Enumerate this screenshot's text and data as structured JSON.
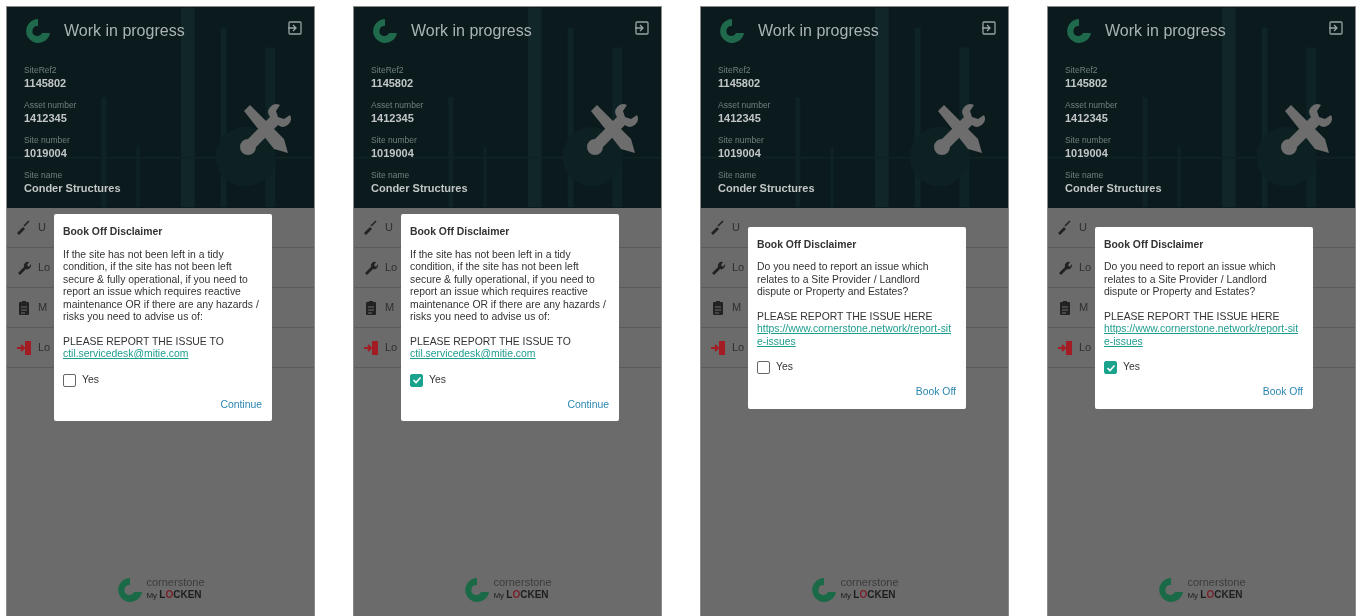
{
  "phones": [
    {
      "header": {
        "title": "Work in progress",
        "fields": [
          {
            "label": "SiteRef2",
            "value": "1145802"
          },
          {
            "label": "Asset number",
            "value": "1412345"
          },
          {
            "label": "Site number",
            "value": "1019004"
          },
          {
            "label": "Site name",
            "value": "Conder Structures"
          }
        ]
      },
      "menu_items": [
        {
          "kind": "brush",
          "label": "U"
        },
        {
          "kind": "wrench",
          "label": "Lo"
        },
        {
          "kind": "clipboard",
          "label": "M"
        },
        {
          "kind": "logout",
          "label": "Lo"
        }
      ],
      "dialog": {
        "title": "Book Off Disclaimer",
        "message": "If the site has not been left in a tidy condition, if the site has not been left secure & fully operational, if you need to report an issue which requires reactive maintenance OR if there are any hazards / risks you need to advise us of:",
        "report_text": "PLEASE REPORT THE ISSUE TO",
        "link": "ctil.servicedesk@mitie.com",
        "checkbox": {
          "label": "Yes",
          "checked": false
        },
        "action": "Continue"
      },
      "footer": {
        "brand": "cornerstone",
        "sub_prefix": "My",
        "sub_start": "L",
        "sub_mark": "O",
        "sub_end": "CKEN"
      }
    },
    {
      "header": {
        "title": "Work in progress",
        "fields": [
          {
            "label": "SiteRef2",
            "value": "1145802"
          },
          {
            "label": "Asset number",
            "value": "1412345"
          },
          {
            "label": "Site number",
            "value": "1019004"
          },
          {
            "label": "Site name",
            "value": "Conder Structures"
          }
        ]
      },
      "menu_items": [
        {
          "kind": "brush",
          "label": "U"
        },
        {
          "kind": "wrench",
          "label": "Lo"
        },
        {
          "kind": "clipboard",
          "label": "M"
        },
        {
          "kind": "logout",
          "label": "Lo"
        }
      ],
      "dialog": {
        "title": "Book Off Disclaimer",
        "message": "If the site has not been left in a tidy condition, if the site has not been left secure & fully operational, if you need to report an issue which requires reactive maintenance OR if there are any hazards / risks you need to advise us of:",
        "report_text": "PLEASE REPORT THE ISSUE TO",
        "link": "ctil.servicedesk@mitie.com",
        "checkbox": {
          "label": "Yes",
          "checked": true
        },
        "action": "Continue"
      },
      "footer": {
        "brand": "cornerstone",
        "sub_prefix": "My",
        "sub_start": "L",
        "sub_mark": "O",
        "sub_end": "CKEN"
      }
    },
    {
      "header": {
        "title": "Work in progress",
        "fields": [
          {
            "label": "SiteRef2",
            "value": "1145802"
          },
          {
            "label": "Asset number",
            "value": "1412345"
          },
          {
            "label": "Site number",
            "value": "1019004"
          },
          {
            "label": "Site name",
            "value": "Conder Structures"
          }
        ]
      },
      "menu_items": [
        {
          "kind": "brush",
          "label": "U"
        },
        {
          "kind": "wrench",
          "label": "Lo"
        },
        {
          "kind": "clipboard",
          "label": "M"
        },
        {
          "kind": "logout",
          "label": "Lo"
        }
      ],
      "dialog": {
        "title": "Book Off Disclaimer",
        "message": "Do you need to report an issue which relates to a Site Provider / Landlord dispute or Property and Estates?",
        "report_text": "PLEASE REPORT THE ISSUE HERE",
        "link": "https://www.cornerstone.network/report-site-issues",
        "checkbox": {
          "label": "Yes",
          "checked": false
        },
        "action": "Book Off"
      },
      "footer": {
        "brand": "cornerstone",
        "sub_prefix": "My",
        "sub_start": "L",
        "sub_mark": "O",
        "sub_end": "CKEN"
      }
    },
    {
      "header": {
        "title": "Work in progress",
        "fields": [
          {
            "label": "SiteRef2",
            "value": "1145802"
          },
          {
            "label": "Asset number",
            "value": "1412345"
          },
          {
            "label": "Site number",
            "value": "1019004"
          },
          {
            "label": "Site name",
            "value": "Conder Structures"
          }
        ]
      },
      "menu_items": [
        {
          "kind": "brush",
          "label": "U"
        },
        {
          "kind": "wrench",
          "label": "Lo"
        },
        {
          "kind": "clipboard",
          "label": "M"
        },
        {
          "kind": "logout",
          "label": "Lo"
        }
      ],
      "dialog": {
        "title": "Book Off Disclaimer",
        "message": "Do you need to report an issue which relates to a Site Provider / Landlord dispute or Property and Estates?",
        "report_text": "PLEASE REPORT THE ISSUE HERE",
        "link": "https://www.cornerstone.network/report-site-issues",
        "checkbox": {
          "label": "Yes",
          "checked": true
        },
        "action": "Book Off"
      },
      "footer": {
        "brand": "cornerstone",
        "sub_prefix": "My",
        "sub_start": "L",
        "sub_mark": "O",
        "sub_end": "CKEN"
      }
    }
  ]
}
